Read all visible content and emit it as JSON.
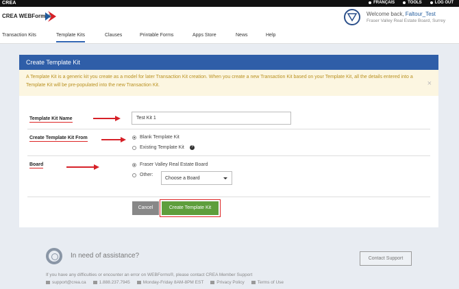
{
  "topbar": {
    "brand": "CREA",
    "francais": "FRANÇAIS",
    "tools": "TOOLS",
    "logout": "LOG OUT"
  },
  "header": {
    "logo": "CREA WEBForms®",
    "welcome_prefix": "Welcome back,",
    "username": "Faltour_Test",
    "board_subtitle": "Fraser Valley Real Estate Board, Surrey"
  },
  "nav": {
    "items": [
      {
        "label": "Transaction Kits"
      },
      {
        "label": "Template Kits"
      },
      {
        "label": "Clauses"
      },
      {
        "label": "Printable Forms"
      },
      {
        "label": "Apps Store"
      },
      {
        "label": "News"
      },
      {
        "label": "Help"
      }
    ],
    "active": "Template Kits"
  },
  "panel": {
    "title": "Create Template Kit",
    "alert": "A Template Kit is a generic kit you create as a model for later Transaction Kit creation. When you create a new Transaction Kit based on your Template Kit, all the details entered into a Template Kit will be pre-populated into the new Transaction Kit.",
    "alert_close": "×"
  },
  "form": {
    "name_label": "Template Kit Name",
    "name_value": "Test Kit 1",
    "from_label": "Create Template Kit From",
    "from_options": [
      "Blank Template Kit",
      "Existing Template Kit"
    ],
    "from_selected": "Blank Template Kit",
    "board_label": "Board",
    "board_options": [
      "Fraser Valley Real Estate Board",
      "Other:"
    ],
    "board_selected": "Fraser Valley Real Estate Board",
    "board_select_value": "Choose a Board",
    "cancel": "Cancel",
    "create": "Create Template Kit"
  },
  "footer": {
    "assist": "In need of assistance?",
    "contact": "Contact Support",
    "note": "If you have any difficulties or encounter an error on WEBForms®, please contact CREA Member Support",
    "email": "support@crea.ca",
    "phone": "1.888.237.7945",
    "hours": "Monday-Friday 8AM-8PM EST",
    "privacy": "Privacy Policy",
    "terms": "Terms of Use"
  },
  "colors": {
    "accent": "#2f5ea8",
    "create_button": "#5e9e3c",
    "annotation": "#d62027"
  }
}
